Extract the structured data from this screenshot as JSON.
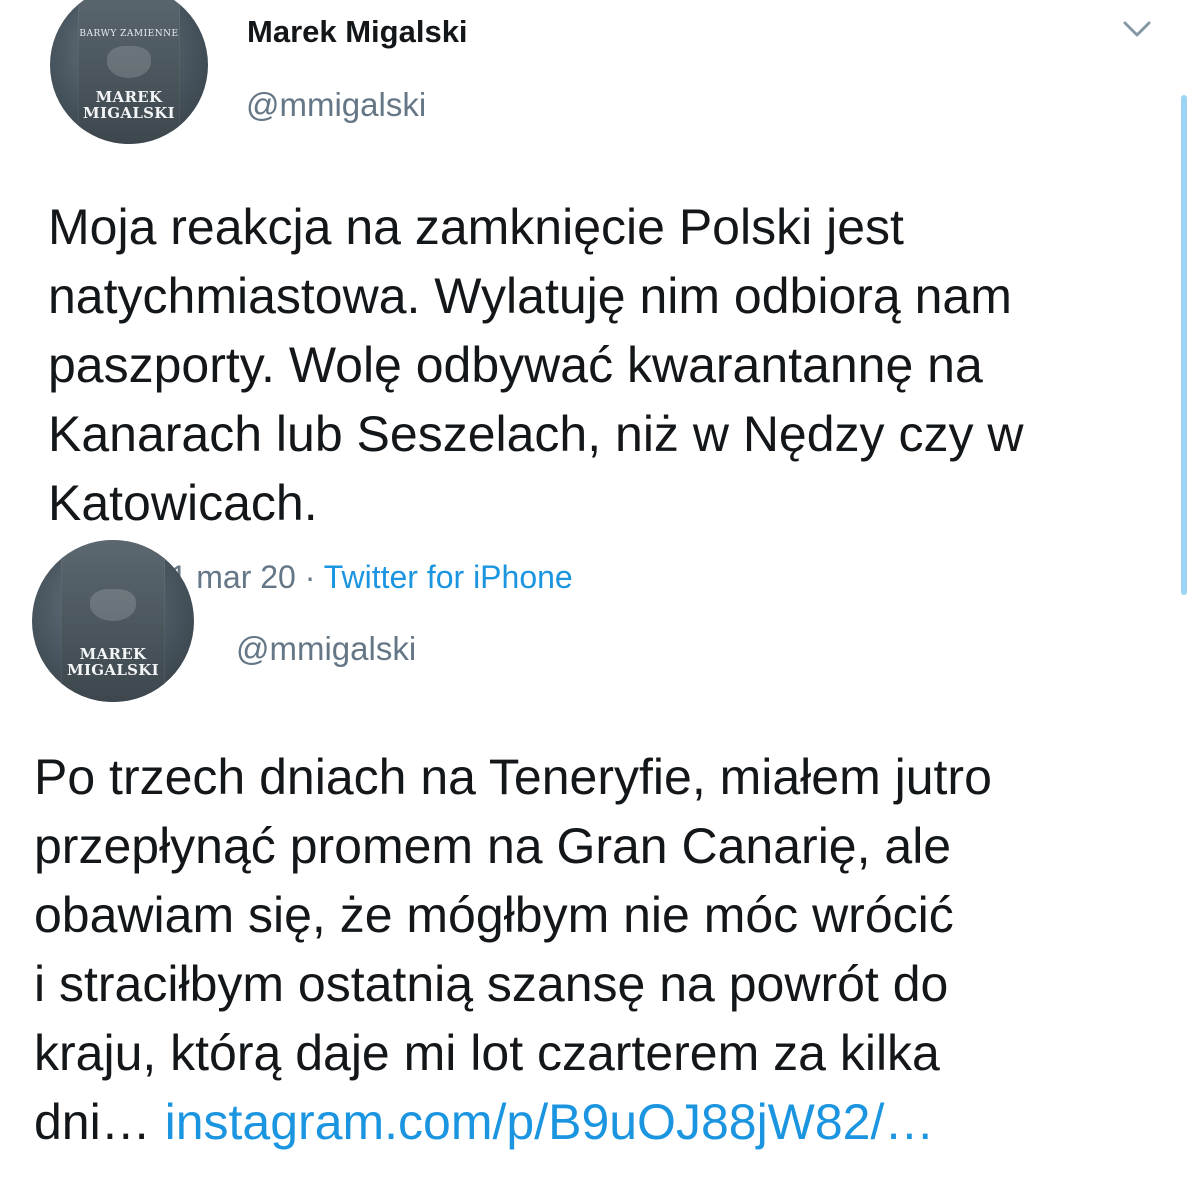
{
  "tweets": [
    {
      "author": {
        "display_name": "Marek Migalski",
        "handle": "@mmigalski",
        "avatar": {
          "series_text": "BARWY ZAMIENNE",
          "author_line1": "MAREK",
          "author_line2": "MIGALSKI"
        }
      },
      "text_lines": [
        "Moja reakcja na zamknięcie Polski jest",
        "natychmiastowa. Wylatuję nim odbiorą nam",
        "paszporty. Wolę odbywać kwarantannę na",
        "Kanarach lub Seszelach, niż w Nędzy czy w",
        "Katowicach."
      ],
      "timestamp": "11:12 · 11 mar 20 · ",
      "source": "Twitter for iPhone",
      "menu_icon": "chevron-down-icon"
    },
    {
      "author": {
        "handle": "@mmigalski",
        "avatar": {
          "author_line1": "MAREK",
          "author_line2": "MIGALSKI"
        }
      },
      "text_lines": [
        "Po trzech dniach na Teneryfie, miałem jutro",
        "przepłynąć promem na Gran Canarię, ale",
        "obawiam się, że mógłbym nie móc wrócić",
        "i straciłbym ostatnią szansę na powrót do",
        "kraju, którą daje mi lot czarterem za kilka"
      ],
      "last_line_prefix": "dni… ",
      "link_text": "instagram.com/p/B9uOJ88jW82/…"
    }
  ],
  "colors": {
    "text": "#14171a",
    "secondary": "#657786",
    "link": "#1b95e0",
    "scrollbar": "#9fd3f3"
  }
}
